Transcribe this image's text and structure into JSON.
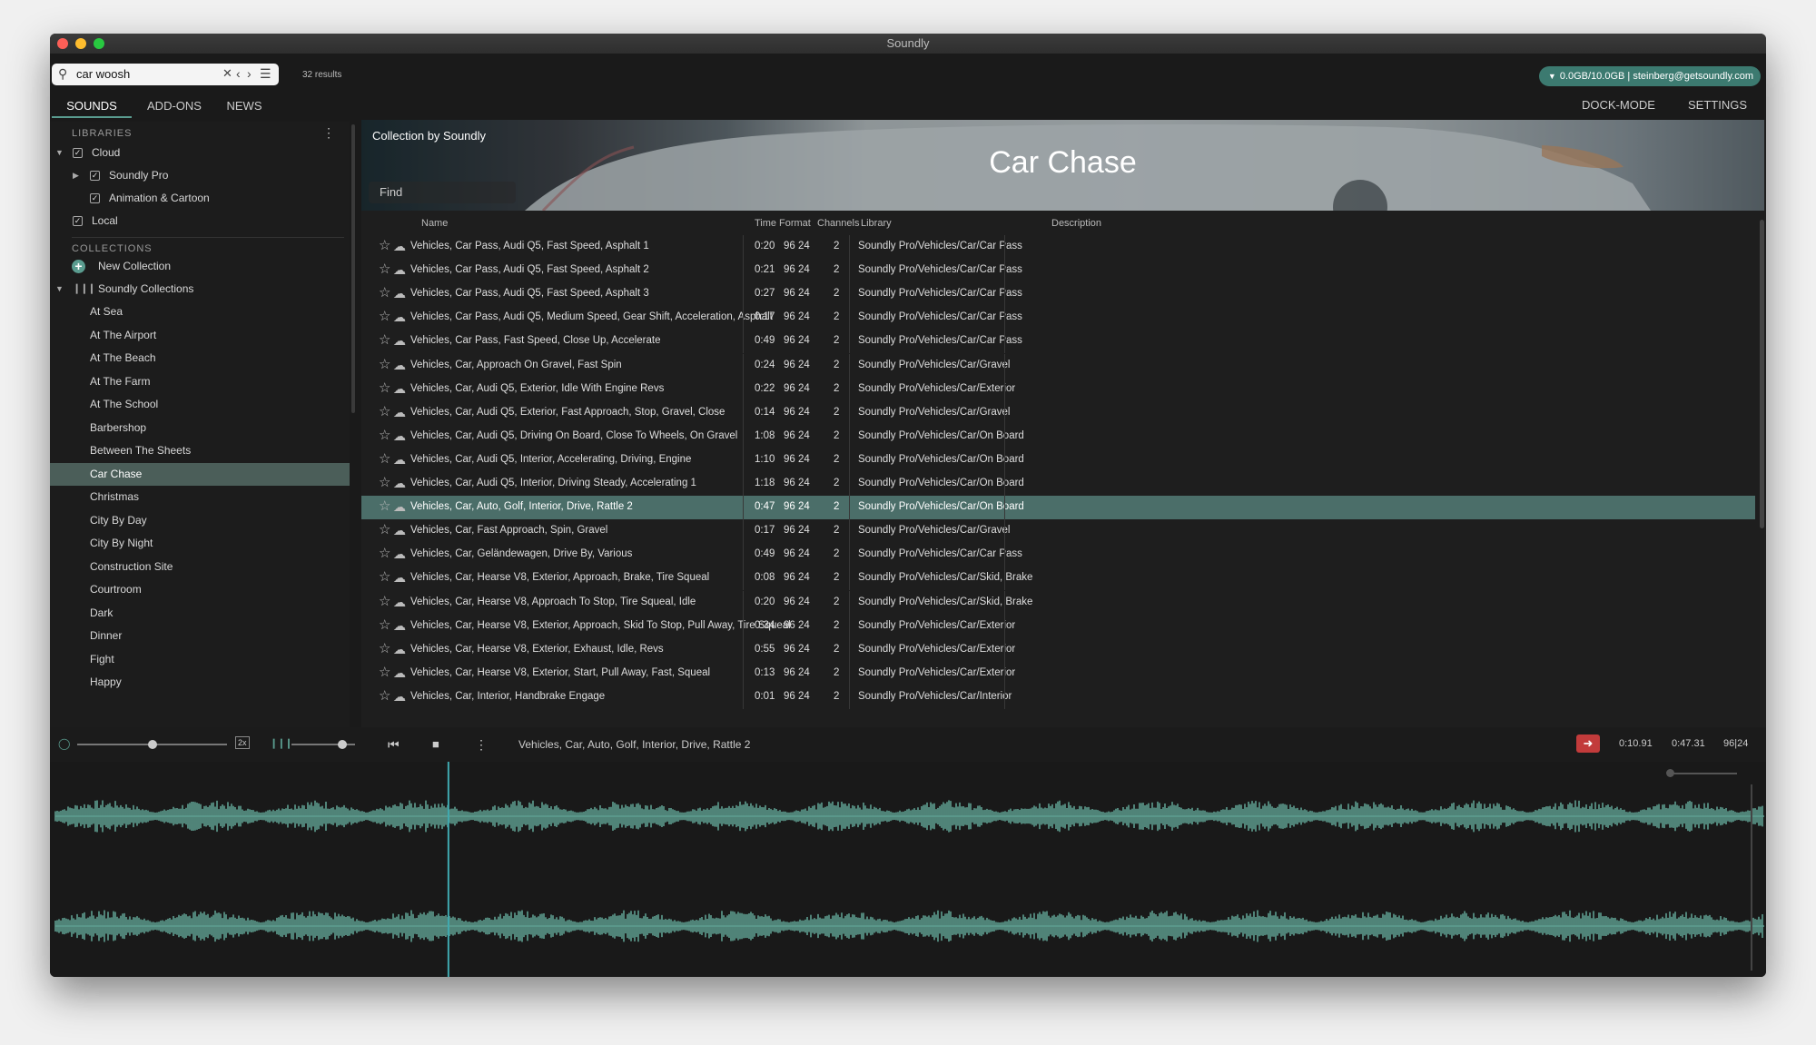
{
  "app": {
    "title": "Soundly",
    "traffic_colors": {
      "close": "#fc5f57",
      "minimize": "#fdbc2e",
      "zoom": "#28c840"
    }
  },
  "search": {
    "query": "car woosh",
    "results": "32 results"
  },
  "account": "0.0GB/10.0GB | steinberg@getsoundly.com",
  "tabs": [
    "SOUNDS",
    "ADD-ONS",
    "NEWS"
  ],
  "right_tabs": [
    "DOCK-MODE",
    "SETTINGS"
  ],
  "sidebar": {
    "libraries_label": "LIBRARIES",
    "libraries": [
      {
        "label": "Cloud",
        "level": 0,
        "expand": "down",
        "checked": true
      },
      {
        "label": "Soundly Pro",
        "level": 1,
        "expand": "right",
        "checked": true
      },
      {
        "label": "Animation & Cartoon",
        "level": 1,
        "expand": "",
        "checked": true
      },
      {
        "label": "Local",
        "level": 0,
        "expand": "",
        "checked": true
      }
    ],
    "collections_label": "COLLECTIONS",
    "new_collection": "New Collection",
    "soundly_collections": "Soundly Collections",
    "collections": [
      "At Sea",
      "At The Airport",
      "At The Beach",
      "At The Farm",
      "At The School",
      "Barbershop",
      "Between The Sheets",
      "Car Chase",
      "Christmas",
      "City By Day",
      "City By Night",
      "Construction Site",
      "Courtroom",
      "Dark",
      "Dinner",
      "Fight",
      "Happy"
    ],
    "selected": "Car Chase"
  },
  "banner": {
    "subtitle": "Collection by Soundly",
    "title": "Car Chase",
    "find_placeholder": "Find"
  },
  "table": {
    "headers": {
      "name": "Name",
      "time": "Time",
      "format": "Format",
      "channels": "Channels",
      "library": "Library",
      "description": "Description"
    },
    "selected_index": 11,
    "rows": [
      {
        "name": "Vehicles, Car Pass, Audi Q5, Fast Speed, Asphalt 1",
        "time": "0:20",
        "format": "96 24",
        "channels": "2",
        "library": "Soundly Pro/Vehicles/Car/Car Pass"
      },
      {
        "name": "Vehicles, Car Pass, Audi Q5, Fast Speed, Asphalt 2",
        "time": "0:21",
        "format": "96 24",
        "channels": "2",
        "library": "Soundly Pro/Vehicles/Car/Car Pass"
      },
      {
        "name": "Vehicles, Car Pass, Audi Q5, Fast Speed, Asphalt 3",
        "time": "0:27",
        "format": "96 24",
        "channels": "2",
        "library": "Soundly Pro/Vehicles/Car/Car Pass"
      },
      {
        "name": "Vehicles, Car Pass, Audi Q5, Medium Speed, Gear Shift, Acceleration, Asphalt",
        "time": "0:17",
        "format": "96 24",
        "channels": "2",
        "library": "Soundly Pro/Vehicles/Car/Car Pass"
      },
      {
        "name": "Vehicles, Car Pass, Fast Speed, Close Up, Accelerate",
        "time": "0:49",
        "format": "96 24",
        "channels": "2",
        "library": "Soundly Pro/Vehicles/Car/Car Pass"
      },
      {
        "name": "Vehicles, Car, Approach On Gravel, Fast Spin",
        "time": "0:24",
        "format": "96 24",
        "channels": "2",
        "library": "Soundly Pro/Vehicles/Car/Gravel"
      },
      {
        "name": "Vehicles, Car, Audi Q5, Exterior, Idle With Engine Revs",
        "time": "0:22",
        "format": "96 24",
        "channels": "2",
        "library": "Soundly Pro/Vehicles/Car/Exterior"
      },
      {
        "name": "Vehicles, Car, Audi Q5, Exterior, Fast Approach, Stop, Gravel, Close",
        "time": "0:14",
        "format": "96 24",
        "channels": "2",
        "library": "Soundly Pro/Vehicles/Car/Gravel"
      },
      {
        "name": "Vehicles, Car, Audi Q5, Driving On Board, Close To Wheels, On Gravel",
        "time": "1:08",
        "format": "96 24",
        "channels": "2",
        "library": "Soundly Pro/Vehicles/Car/On Board"
      },
      {
        "name": "Vehicles, Car, Audi Q5, Interior, Accelerating, Driving, Engine",
        "time": "1:10",
        "format": "96 24",
        "channels": "2",
        "library": "Soundly Pro/Vehicles/Car/On Board"
      },
      {
        "name": "Vehicles, Car, Audi Q5, Interior, Driving Steady, Accelerating 1",
        "time": "1:18",
        "format": "96 24",
        "channels": "2",
        "library": "Soundly Pro/Vehicles/Car/On Board"
      },
      {
        "name": "Vehicles, Car, Auto, Golf, Interior, Drive, Rattle 2",
        "time": "0:47",
        "format": "96 24",
        "channels": "2",
        "library": "Soundly Pro/Vehicles/Car/On Board"
      },
      {
        "name": "Vehicles, Car, Fast Approach, Spin, Gravel",
        "time": "0:17",
        "format": "96 24",
        "channels": "2",
        "library": "Soundly Pro/Vehicles/Car/Gravel"
      },
      {
        "name": "Vehicles, Car, Geländewagen, Drive By, Various",
        "time": "0:49",
        "format": "96 24",
        "channels": "2",
        "library": "Soundly Pro/Vehicles/Car/Car Pass"
      },
      {
        "name": "Vehicles, Car, Hearse V8, Exterior, Approach, Brake, Tire Squeal",
        "time": "0:08",
        "format": "96 24",
        "channels": "2",
        "library": "Soundly Pro/Vehicles/Car/Skid, Brake"
      },
      {
        "name": "Vehicles, Car, Hearse V8, Approach To Stop, Tire Squeal, Idle",
        "time": "0:20",
        "format": "96 24",
        "channels": "2",
        "library": "Soundly Pro/Vehicles/Car/Skid, Brake"
      },
      {
        "name": "Vehicles, Car, Hearse V8, Exterior, Approach, Skid To Stop, Pull Away, Tire Squeal",
        "time": "0:34",
        "format": "96 24",
        "channels": "2",
        "library": "Soundly Pro/Vehicles/Car/Exterior"
      },
      {
        "name": "Vehicles, Car, Hearse V8, Exterior, Exhaust, Idle, Revs",
        "time": "0:55",
        "format": "96 24",
        "channels": "2",
        "library": "Soundly Pro/Vehicles/Car/Exterior"
      },
      {
        "name": "Vehicles, Car, Hearse V8, Exterior, Start, Pull Away, Fast, Squeal",
        "time": "0:13",
        "format": "96 24",
        "channels": "2",
        "library": "Soundly Pro/Vehicles/Car/Exterior"
      },
      {
        "name": "Vehicles, Car, Interior, Handbrake Engage",
        "time": "0:01",
        "format": "96 24",
        "channels": "2",
        "library": "Soundly Pro/Vehicles/Car/Interior"
      }
    ]
  },
  "transport": {
    "rate_label": "2x",
    "now_playing": "Vehicles, Car, Auto, Golf, Interior, Drive, Rattle 2",
    "position": "0:10.91",
    "duration": "0:47.31",
    "format": "96|24",
    "speed_value": 0.5,
    "volume_value": 0.8
  },
  "waveform": {
    "color": "#5e9e90",
    "playhead_fraction": 0.23
  },
  "colors": {
    "accent": "#5a9c8f",
    "selection": "#4b6e69"
  }
}
